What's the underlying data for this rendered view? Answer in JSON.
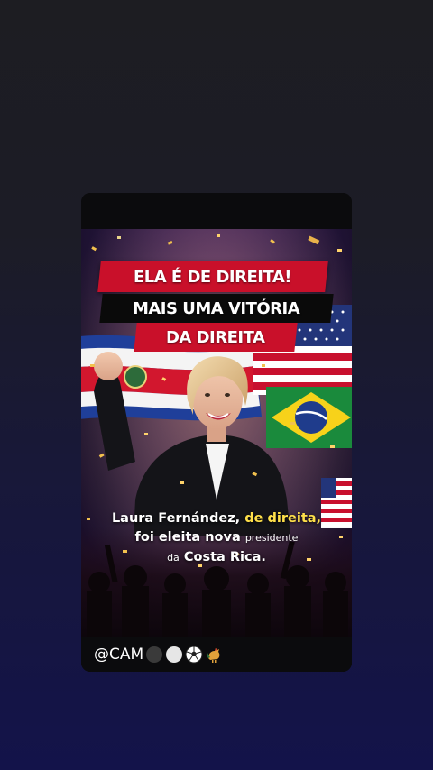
{
  "story": {
    "headline_line1": "ELA É DE DIREITA!",
    "headline_line2": "MAIS UMA VITÓRIA",
    "headline_line3": "DA DIREITA",
    "caption": {
      "name": "Laura Fernández,",
      "highlight": "de direita,",
      "line2_main": "foi eleita nova",
      "line2_small": "presidente",
      "line3_prefix": "da",
      "line3_main": "Costa Rica."
    },
    "handle": "@CAM",
    "handle_emojis": [
      "black-circle-icon",
      "white-circle-icon",
      "soccer-ball-icon",
      "rooster-icon"
    ]
  },
  "colors": {
    "accent_red": "#c9102a",
    "highlight_yellow": "#ffe04a",
    "background_top": "#1d1d22",
    "background_bottom": "#13134a"
  }
}
